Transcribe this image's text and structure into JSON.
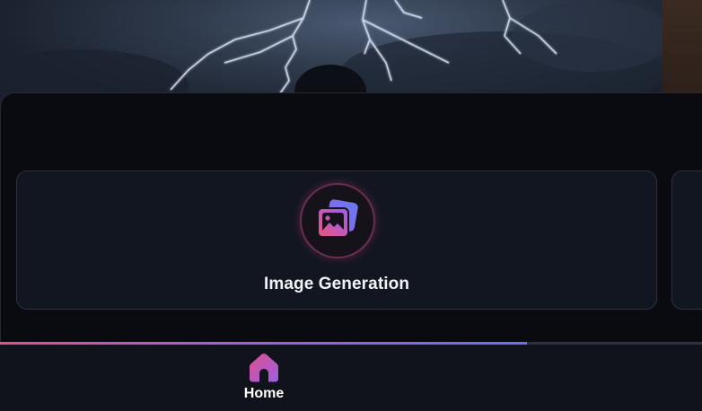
{
  "hero": {
    "description_icon": "lightning-storm-image"
  },
  "feature_card": {
    "label": "Image Generation",
    "icon": "image-gallery-icon"
  },
  "progress": {
    "fraction": 0.75
  },
  "bottom_nav": {
    "items": [
      {
        "label": "Home",
        "icon": "home-icon",
        "active": true
      }
    ]
  },
  "colors": {
    "accent_pink": "#e4508a",
    "accent_purple": "#a65ee0",
    "accent_blue": "#6a70f0",
    "sheet_bg": "#090b10",
    "card_bg": "#121620"
  }
}
